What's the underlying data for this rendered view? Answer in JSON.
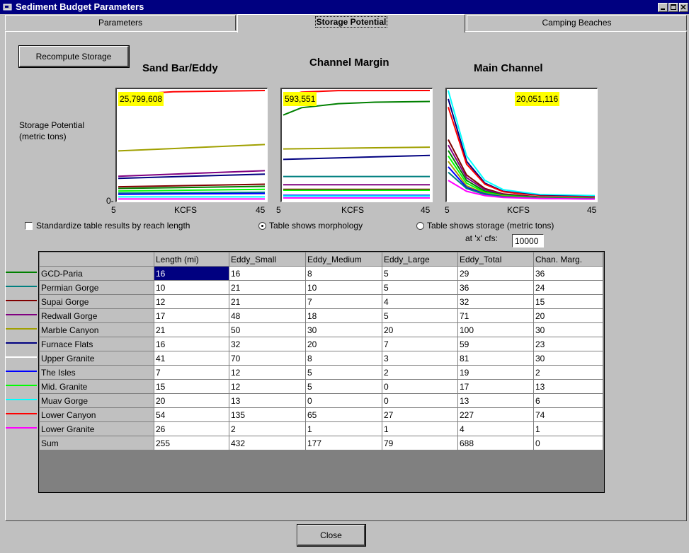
{
  "window": {
    "title": "Sediment Budget Parameters"
  },
  "tabs": [
    {
      "label": "Parameters"
    },
    {
      "label": "Storage Potential"
    },
    {
      "label": "Camping Beaches"
    }
  ],
  "recompute_label": "Recompute Storage",
  "y_axis_label_line1": "Storage Potential",
  "y_axis_label_line2": "(metric tons)",
  "y_axis_zero": "0-",
  "charts": [
    {
      "title": "Sand Bar/Eddy",
      "max_label": "25,799,608",
      "x_min": "5",
      "x_max": "45",
      "x_label": "KCFS"
    },
    {
      "title": "Channel Margin",
      "max_label": "593,551",
      "x_min": "5",
      "x_max": "45",
      "x_label": "KCFS"
    },
    {
      "title": "Main Channel",
      "max_label": "20,051,116",
      "x_min": "5",
      "x_max": "45",
      "x_label": "KCFS"
    }
  ],
  "chart_data": [
    {
      "type": "line",
      "title": "Sand Bar/Eddy",
      "xlabel": "KCFS",
      "ylabel": "Storage Potential (metric tons)",
      "xlim": [
        5,
        45
      ],
      "ylim": [
        0,
        25799608
      ],
      "series": [
        {
          "name": "Lower Canyon",
          "color": "#ff0000",
          "x": [
            5,
            10,
            20,
            45
          ],
          "y": [
            24500000,
            25000000,
            25500000,
            25799608
          ]
        },
        {
          "name": "Marble Canyon",
          "color": "#a0a000",
          "x": [
            5,
            45
          ],
          "y": [
            11500000,
            13000000
          ]
        },
        {
          "name": "Redwall Gorge",
          "color": "#800080",
          "x": [
            5,
            45
          ],
          "y": [
            5500000,
            6800000
          ]
        },
        {
          "name": "Furnace Flats",
          "color": "#000080",
          "x": [
            5,
            45
          ],
          "y": [
            5000000,
            6000000
          ]
        },
        {
          "name": "Upper Granite",
          "color": "#ffffff",
          "x": [
            5,
            45
          ],
          "y": [
            4000000,
            5000000
          ]
        },
        {
          "name": "Supai Gorge",
          "color": "#800000",
          "x": [
            5,
            45
          ],
          "y": [
            3000000,
            3600000
          ]
        },
        {
          "name": "GCD-Paria",
          "color": "#008000",
          "x": [
            5,
            45
          ],
          "y": [
            2600000,
            3100000
          ]
        },
        {
          "name": "Mid. Granite",
          "color": "#00ff00",
          "x": [
            5,
            45
          ],
          "y": [
            2000000,
            2400000
          ]
        },
        {
          "name": "Permian Gorge",
          "color": "#008080",
          "x": [
            5,
            45
          ],
          "y": [
            1500000,
            1700000
          ]
        },
        {
          "name": "The Isles",
          "color": "#0000ff",
          "x": [
            5,
            45
          ],
          "y": [
            1200000,
            1400000
          ]
        },
        {
          "name": "Muav Gorge",
          "color": "#00ffff",
          "x": [
            5,
            45
          ],
          "y": [
            600000,
            600000
          ]
        },
        {
          "name": "Lower Granite",
          "color": "#ff00ff",
          "x": [
            5,
            45
          ],
          "y": [
            100000,
            100000
          ]
        }
      ]
    },
    {
      "type": "line",
      "title": "Channel Margin",
      "xlabel": "KCFS",
      "xlim": [
        5,
        45
      ],
      "ylim": [
        0,
        593551
      ],
      "series": [
        {
          "name": "Lower Canyon",
          "color": "#ff0000",
          "x": [
            5,
            10,
            20,
            45
          ],
          "y": [
            560000,
            585000,
            593000,
            593551
          ]
        },
        {
          "name": "GCD-Paria",
          "color": "#008000",
          "x": [
            5,
            10,
            20,
            30,
            45
          ],
          "y": [
            460000,
            500000,
            522000,
            530000,
            534000
          ]
        },
        {
          "name": "Marble Canyon",
          "color": "#a0a000",
          "x": [
            5,
            45
          ],
          "y": [
            275000,
            285000
          ]
        },
        {
          "name": "Furnace Flats",
          "color": "#000080",
          "x": [
            5,
            45
          ],
          "y": [
            218000,
            240000
          ]
        },
        {
          "name": "Permian Gorge",
          "color": "#008080",
          "x": [
            5,
            45
          ],
          "y": [
            125000,
            125000
          ]
        },
        {
          "name": "Upper Granite",
          "color": "#ffffff",
          "x": [
            5,
            45
          ],
          "y": [
            90000,
            90000
          ]
        },
        {
          "name": "Redwall Gorge",
          "color": "#800080",
          "x": [
            5,
            45
          ],
          "y": [
            80000,
            80000
          ]
        },
        {
          "name": "Supai Gorge",
          "color": "#800000",
          "x": [
            5,
            45
          ],
          "y": [
            55000,
            55000
          ]
        },
        {
          "name": "Mid. Granite",
          "color": "#00ff00",
          "x": [
            5,
            45
          ],
          "y": [
            50000,
            50000
          ]
        },
        {
          "name": "The Isles",
          "color": "#0000ff",
          "x": [
            5,
            45
          ],
          "y": [
            22000,
            22000
          ]
        },
        {
          "name": "Muav Gorge",
          "color": "#00ffff",
          "x": [
            5,
            45
          ],
          "y": [
            18000,
            18000
          ]
        },
        {
          "name": "Lower Granite",
          "color": "#ff00ff",
          "x": [
            5,
            45
          ],
          "y": [
            8000,
            8000
          ]
        }
      ]
    },
    {
      "type": "line",
      "title": "Main Channel",
      "xlabel": "KCFS",
      "xlim": [
        5,
        45
      ],
      "ylim": [
        0,
        20051116
      ],
      "series": [
        {
          "name": "Muav Gorge",
          "color": "#00ffff",
          "x": [
            5,
            10,
            15,
            20,
            30,
            45
          ],
          "y": [
            20051116,
            8000000,
            3500000,
            1800000,
            900000,
            700000
          ]
        },
        {
          "name": "Furnace Flats",
          "color": "#000080",
          "x": [
            5,
            10,
            15,
            20,
            30,
            45
          ],
          "y": [
            18500000,
            7000000,
            3000000,
            1500000,
            700000,
            500000
          ]
        },
        {
          "name": "Lower Canyon",
          "color": "#ff0000",
          "x": [
            5,
            10,
            15,
            20,
            30,
            45
          ],
          "y": [
            17000000,
            6500000,
            2800000,
            1400000,
            600000,
            400000
          ]
        },
        {
          "name": "Upper Granite",
          "color": "#ffffff",
          "x": [
            5,
            10,
            15,
            20,
            30,
            45
          ],
          "y": [
            12000000,
            5000000,
            2200000,
            1100000,
            500000,
            300000
          ]
        },
        {
          "name": "Supai Gorge",
          "color": "#800000",
          "x": [
            5,
            10,
            15,
            20,
            30,
            45
          ],
          "y": [
            11000000,
            4500000,
            2000000,
            1000000,
            450000,
            250000
          ]
        },
        {
          "name": "Redwall Gorge",
          "color": "#800080",
          "x": [
            5,
            10,
            15,
            20,
            30,
            45
          ],
          "y": [
            10000000,
            4000000,
            1800000,
            900000,
            400000,
            200000
          ]
        },
        {
          "name": "GCD-Paria",
          "color": "#008000",
          "x": [
            5,
            10,
            15,
            20,
            30,
            45
          ],
          "y": [
            9000000,
            3500000,
            1500000,
            800000,
            350000,
            200000
          ]
        },
        {
          "name": "Mid. Granite",
          "color": "#00ff00",
          "x": [
            5,
            10,
            15,
            20,
            30,
            45
          ],
          "y": [
            8000000,
            3000000,
            1300000,
            700000,
            300000,
            150000
          ]
        },
        {
          "name": "Marble Canyon",
          "color": "#a0a000",
          "x": [
            5,
            10,
            15,
            20,
            30,
            45
          ],
          "y": [
            7000000,
            2500000,
            1100000,
            600000,
            250000,
            120000
          ]
        },
        {
          "name": "The Isles",
          "color": "#0000ff",
          "x": [
            5,
            10,
            15,
            20,
            30,
            45
          ],
          "y": [
            6000000,
            2200000,
            1000000,
            500000,
            200000,
            100000
          ]
        },
        {
          "name": "Permian Gorge",
          "color": "#008080",
          "x": [
            5,
            10,
            15,
            20,
            30,
            45
          ],
          "y": [
            5000000,
            2000000,
            900000,
            450000,
            180000,
            80000
          ]
        },
        {
          "name": "Lower Granite",
          "color": "#ff00ff",
          "x": [
            5,
            10,
            15,
            20,
            30,
            45
          ],
          "y": [
            3500000,
            1500000,
            700000,
            350000,
            150000,
            60000
          ]
        }
      ]
    }
  ],
  "options": {
    "standardize_label": "Standardize table results by reach length",
    "standardize_checked": false,
    "morphology_label": "Table shows morphology",
    "morphology_selected": true,
    "storage_label": "Table shows storage (metric tons)",
    "storage_selected": false,
    "x_cfs_label": "at 'x' cfs:",
    "x_cfs_value": "10000"
  },
  "table": {
    "headers": [
      "",
      "Length (mi)",
      "Eddy_Small",
      "Eddy_Medium",
      "Eddy_Large",
      "Eddy_Total",
      "Chan. Marg."
    ],
    "rows": [
      {
        "name": "GCD-Paria",
        "color": "#008000",
        "values": [
          "16",
          "16",
          "8",
          "5",
          "29",
          "36"
        ]
      },
      {
        "name": "Permian Gorge",
        "color": "#008080",
        "values": [
          "10",
          "21",
          "10",
          "5",
          "36",
          "24"
        ]
      },
      {
        "name": "Supai Gorge",
        "color": "#800000",
        "values": [
          "12",
          "21",
          "7",
          "4",
          "32",
          "15"
        ]
      },
      {
        "name": "Redwall Gorge",
        "color": "#800080",
        "values": [
          "17",
          "48",
          "18",
          "5",
          "71",
          "20"
        ]
      },
      {
        "name": "Marble Canyon",
        "color": "#a0a000",
        "values": [
          "21",
          "50",
          "30",
          "20",
          "100",
          "30"
        ]
      },
      {
        "name": "Furnace Flats",
        "color": "#000080",
        "values": [
          "16",
          "32",
          "20",
          "7",
          "59",
          "23"
        ]
      },
      {
        "name": "Upper Granite",
        "color": "#ffffff",
        "values": [
          "41",
          "70",
          "8",
          "3",
          "81",
          "30"
        ]
      },
      {
        "name": "The Isles",
        "color": "#0000ff",
        "values": [
          "7",
          "12",
          "5",
          "2",
          "19",
          "2"
        ]
      },
      {
        "name": "Mid. Granite",
        "color": "#00ff00",
        "values": [
          "15",
          "12",
          "5",
          "0",
          "17",
          "13"
        ]
      },
      {
        "name": "Muav Gorge",
        "color": "#00ffff",
        "values": [
          "20",
          "13",
          "0",
          "0",
          "13",
          "6"
        ]
      },
      {
        "name": "Lower Canyon",
        "color": "#ff0000",
        "values": [
          "54",
          "135",
          "65",
          "27",
          "227",
          "74"
        ]
      },
      {
        "name": "Lower Granite",
        "color": "#ff00ff",
        "values": [
          "26",
          "2",
          "1",
          "1",
          "4",
          "1"
        ]
      },
      {
        "name": "Sum",
        "color": "",
        "values": [
          "255",
          "432",
          "177",
          "79",
          "688",
          "0"
        ]
      }
    ]
  },
  "close_label": "Close"
}
